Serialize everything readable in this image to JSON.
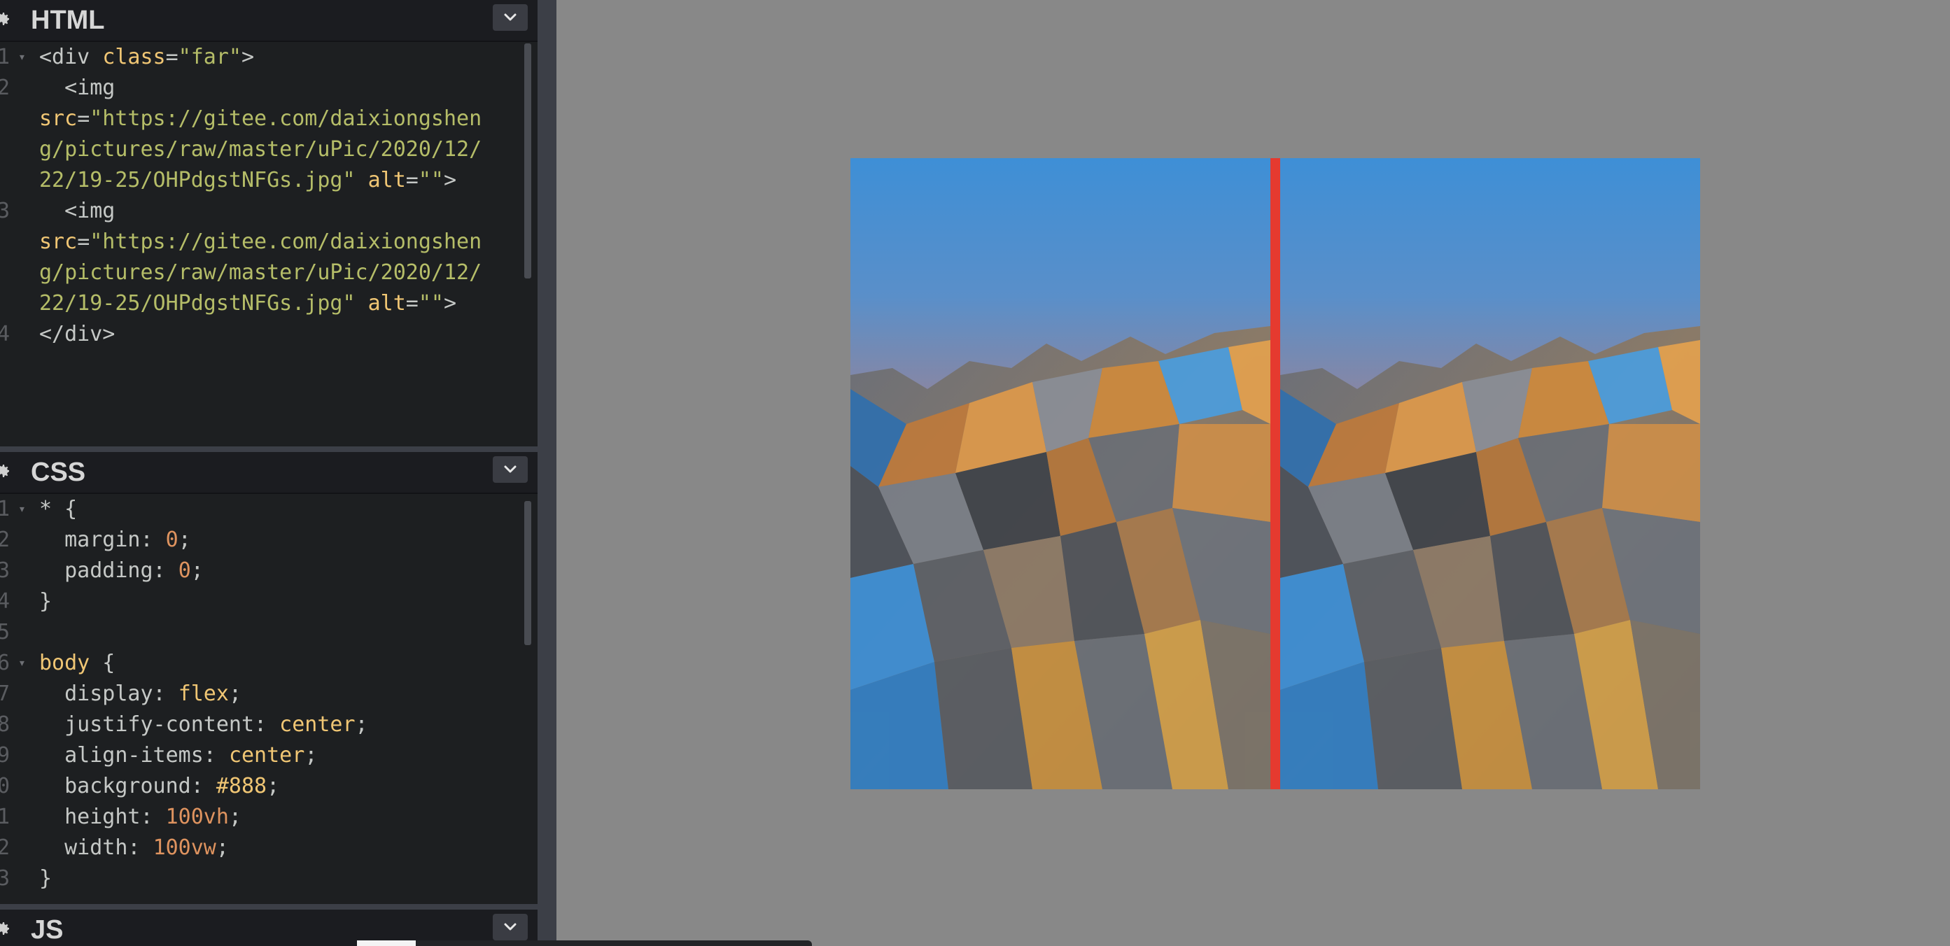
{
  "colors": {
    "editor_bg": "#1d1f21",
    "preview_bg": "#888888",
    "divider_red": "#e53a2f",
    "string": "#b5bd68",
    "keyword": "#f0c674",
    "number": "#de935f"
  },
  "html_pane": {
    "title": "HTML",
    "lines": [
      {
        "n": "1",
        "fold": "▾",
        "tokens": [
          [
            "tag",
            "<div "
          ],
          [
            "attr",
            "class"
          ],
          [
            "punct",
            "="
          ],
          [
            "str",
            "\"far\""
          ],
          [
            "tag",
            ">"
          ]
        ]
      },
      {
        "n": "2",
        "fold": "",
        "tokens": [
          [
            "tag",
            "  <img"
          ]
        ]
      },
      {
        "n": "",
        "fold": "",
        "tokens": [
          [
            "attr",
            "src"
          ],
          [
            "punct",
            "="
          ],
          [
            "str",
            "\"https://gitee.com/daixiongshen"
          ]
        ]
      },
      {
        "n": "",
        "fold": "",
        "tokens": [
          [
            "str",
            "g/pictures/raw/master/uPic/2020/12/"
          ]
        ]
      },
      {
        "n": "",
        "fold": "",
        "tokens": [
          [
            "str",
            "22/19-25/OHPdgstNFGs.jpg\""
          ],
          [
            "punct",
            " "
          ],
          [
            "attr",
            "alt"
          ],
          [
            "punct",
            "="
          ],
          [
            "str",
            "\"\""
          ],
          [
            "tag",
            ">"
          ]
        ]
      },
      {
        "n": "3",
        "fold": "",
        "tokens": [
          [
            "tag",
            "  <img"
          ]
        ]
      },
      {
        "n": "",
        "fold": "",
        "tokens": [
          [
            "attr",
            "src"
          ],
          [
            "punct",
            "="
          ],
          [
            "str",
            "\"https://gitee.com/daixiongshen"
          ]
        ]
      },
      {
        "n": "",
        "fold": "",
        "tokens": [
          [
            "str",
            "g/pictures/raw/master/uPic/2020/12/"
          ]
        ]
      },
      {
        "n": "",
        "fold": "",
        "tokens": [
          [
            "str",
            "22/19-25/OHPdgstNFGs.jpg\""
          ],
          [
            "punct",
            " "
          ],
          [
            "attr",
            "alt"
          ],
          [
            "punct",
            "="
          ],
          [
            "str",
            "\"\""
          ],
          [
            "tag",
            ">"
          ]
        ]
      },
      {
        "n": "4",
        "fold": "",
        "tokens": [
          [
            "tag",
            "</div>"
          ]
        ]
      }
    ]
  },
  "css_pane": {
    "title": "CSS",
    "lines": [
      {
        "n": "1",
        "fold": "▾",
        "tokens": [
          [
            "punct",
            "* {"
          ]
        ]
      },
      {
        "n": "2",
        "fold": "",
        "tokens": [
          [
            "prop",
            "  margin: "
          ],
          [
            "num",
            "0"
          ],
          [
            "punct",
            ";"
          ]
        ]
      },
      {
        "n": "3",
        "fold": "",
        "tokens": [
          [
            "prop",
            "  padding: "
          ],
          [
            "num",
            "0"
          ],
          [
            "punct",
            ";"
          ]
        ]
      },
      {
        "n": "4",
        "fold": "",
        "tokens": [
          [
            "punct",
            "}"
          ]
        ]
      },
      {
        "n": "5",
        "fold": "",
        "tokens": []
      },
      {
        "n": "6",
        "fold": "▾",
        "tokens": [
          [
            "sel",
            "body"
          ],
          [
            "punct",
            " {"
          ]
        ]
      },
      {
        "n": "7",
        "fold": "",
        "tokens": [
          [
            "prop",
            "  display: "
          ],
          [
            "kw",
            "flex"
          ],
          [
            "punct",
            ";"
          ]
        ]
      },
      {
        "n": "8",
        "fold": "",
        "tokens": [
          [
            "prop",
            "  justify-content: "
          ],
          [
            "kw",
            "center"
          ],
          [
            "punct",
            ";"
          ]
        ]
      },
      {
        "n": "9",
        "fold": "",
        "tokens": [
          [
            "prop",
            "  align-items: "
          ],
          [
            "kw",
            "center"
          ],
          [
            "punct",
            ";"
          ]
        ]
      },
      {
        "n": "0",
        "fold": "",
        "tokens": [
          [
            "prop",
            "  background: "
          ],
          [
            "kw",
            "#888"
          ],
          [
            "punct",
            ";"
          ]
        ]
      },
      {
        "n": "1",
        "fold": "",
        "tokens": [
          [
            "prop",
            "  height: "
          ],
          [
            "num",
            "100vh"
          ],
          [
            "punct",
            ";"
          ]
        ]
      },
      {
        "n": "2",
        "fold": "",
        "tokens": [
          [
            "prop",
            "  width: "
          ],
          [
            "num",
            "100vw"
          ],
          [
            "punct",
            ";"
          ]
        ]
      },
      {
        "n": "3",
        "fold": "",
        "tokens": [
          [
            "punct",
            "}"
          ]
        ]
      }
    ]
  },
  "js_pane": {
    "title": "JS"
  },
  "icons": {
    "settings": "gear-icon",
    "collapse": "chevron-down-icon"
  }
}
